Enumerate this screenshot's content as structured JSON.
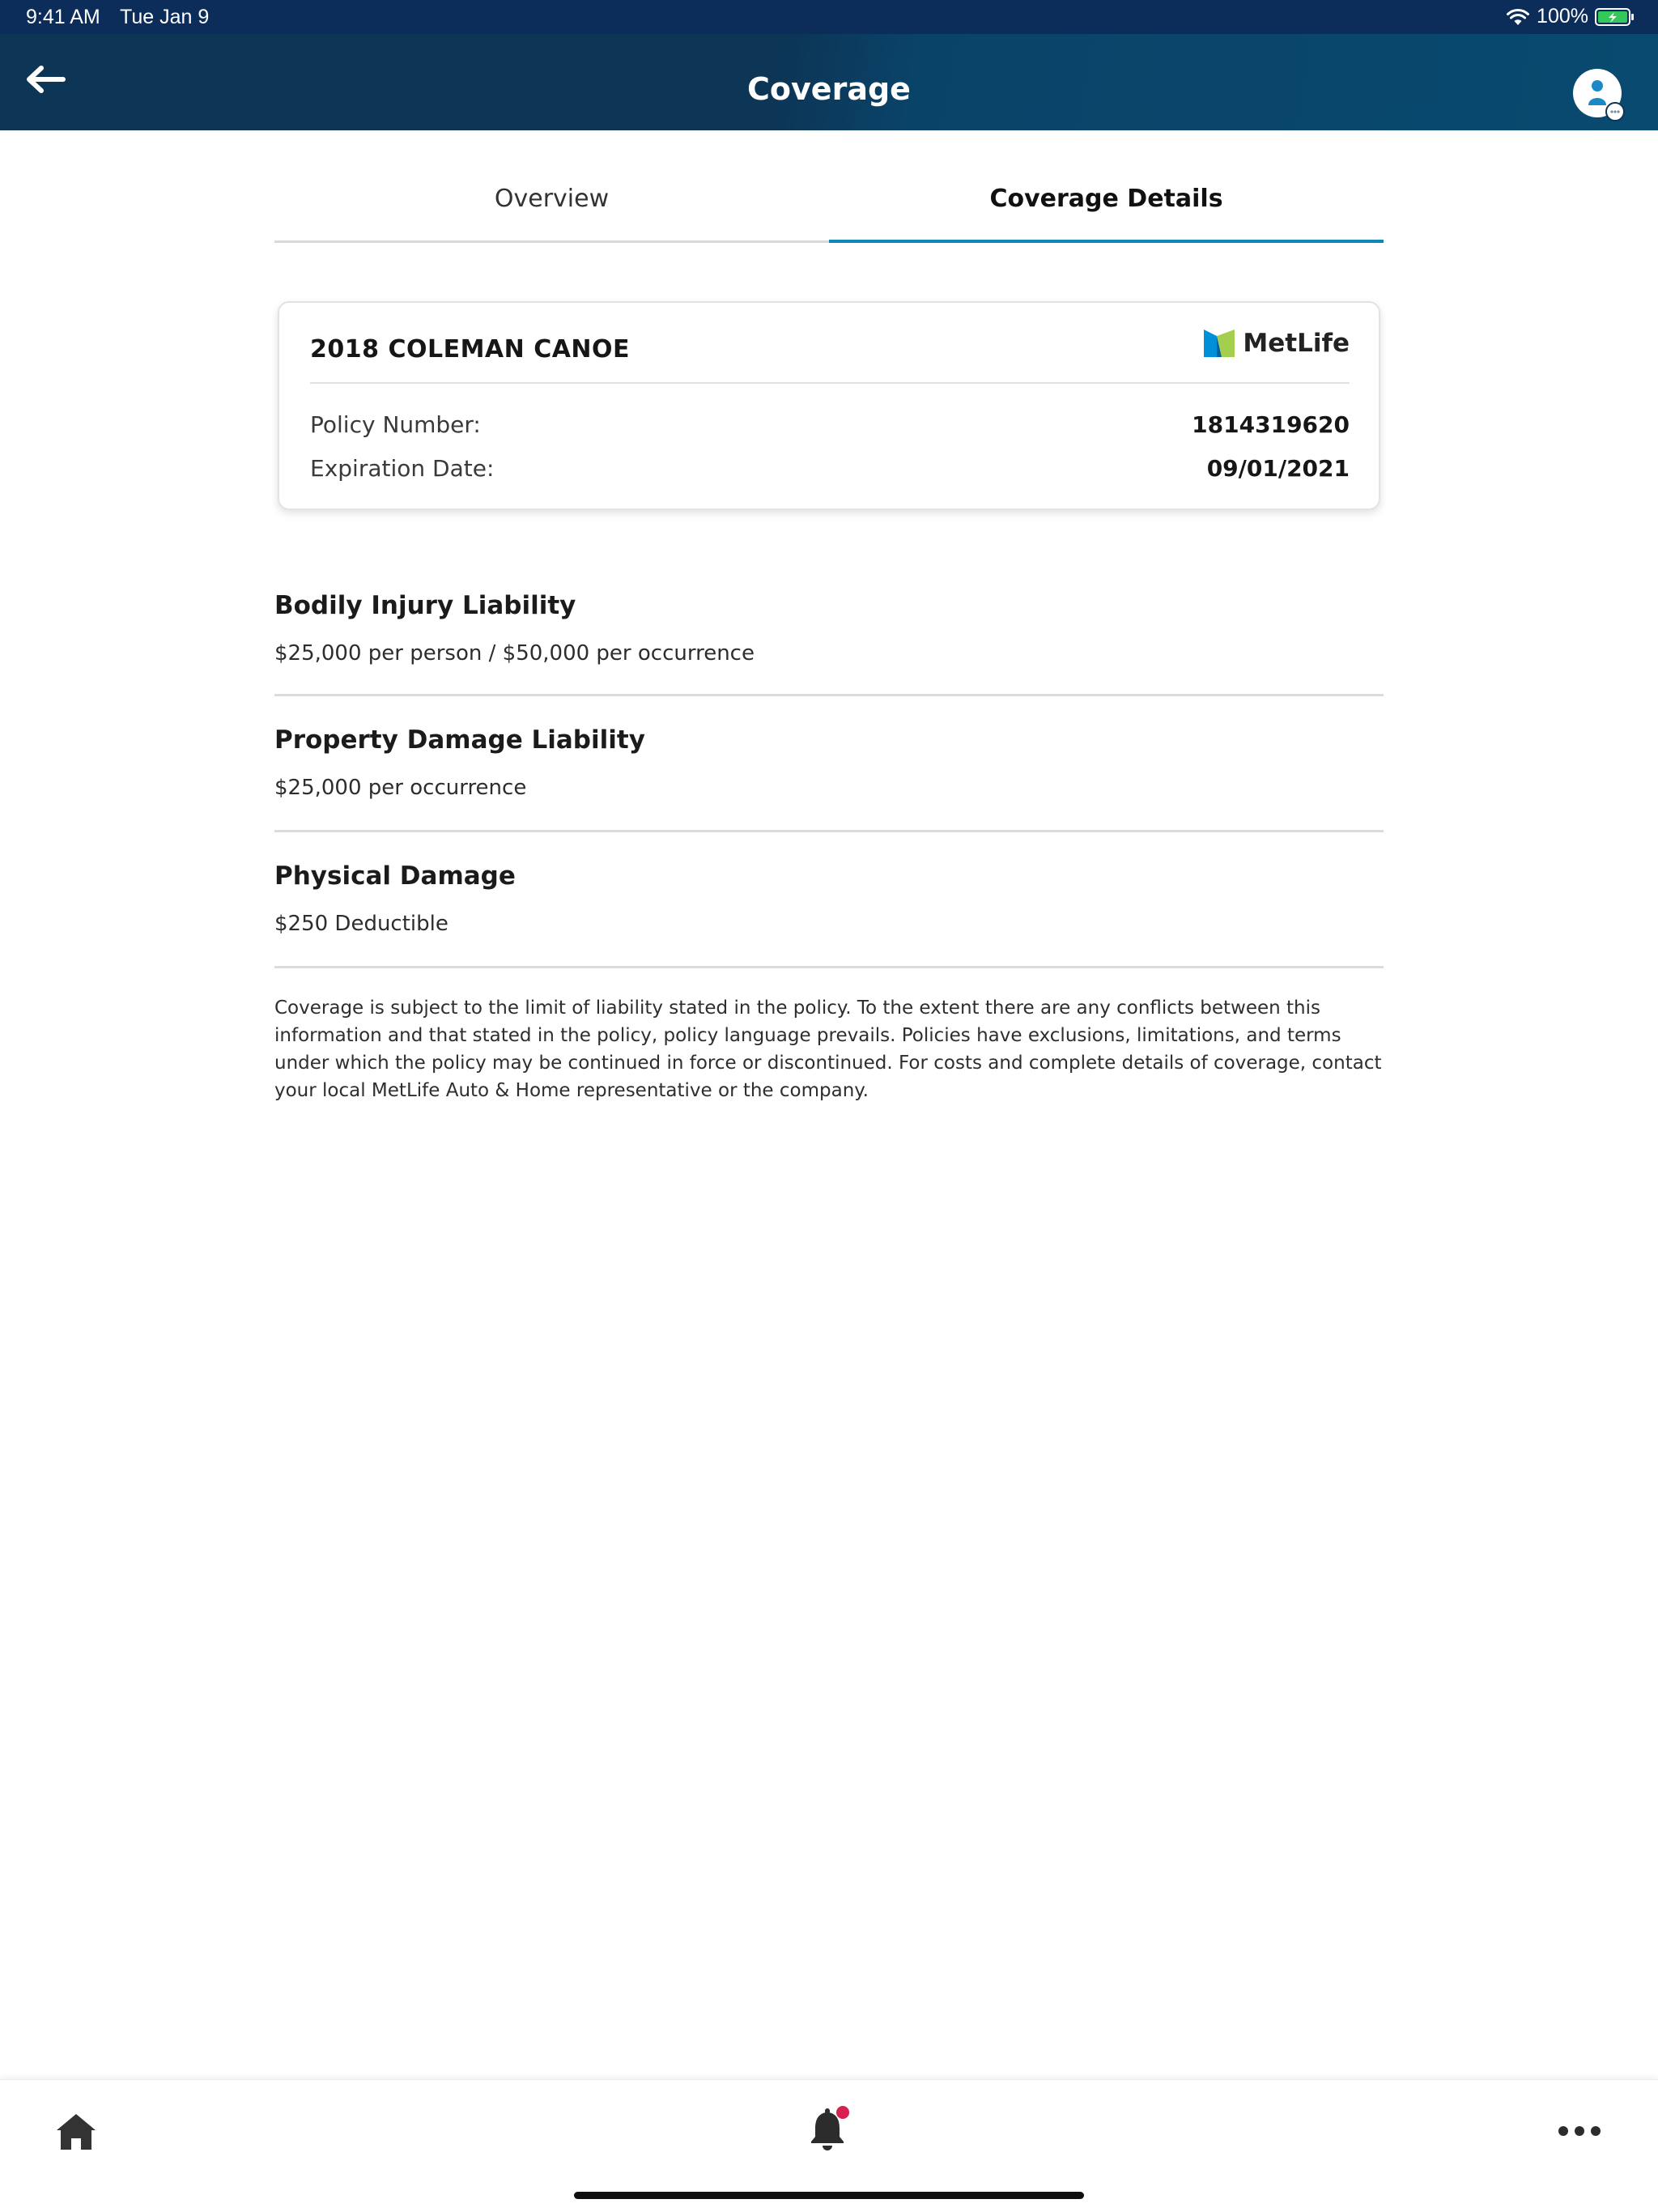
{
  "status_bar": {
    "time": "9:41 AM",
    "date": "Tue Jan 9",
    "battery": "100%",
    "icons": [
      "wifi-icon",
      "battery-charging-icon"
    ]
  },
  "nav": {
    "title": "Coverage",
    "back_icon": "arrow-left-icon",
    "profile_icon": "user-avatar-icon"
  },
  "tabs": [
    {
      "label": "Overview",
      "active": false
    },
    {
      "label": "Coverage Details",
      "active": true
    }
  ],
  "policy_card": {
    "vehicle": "2018 COLEMAN CANOE",
    "carrier": "MetLife",
    "rows": [
      {
        "label": "Policy Number:",
        "value": "1814319620"
      },
      {
        "label": "Expiration Date:",
        "value": "09/01/2021"
      }
    ]
  },
  "coverages": [
    {
      "name": "Bodily Injury Liability",
      "value": "$25,000 per person / $50,000 per occurrence"
    },
    {
      "name": "Property Damage Liability",
      "value": "$25,000 per occurrence"
    },
    {
      "name": "Physical Damage",
      "value": "$250 Deductible"
    }
  ],
  "disclaimer": "Coverage is subject to the limit of liability stated in the policy. To the extent there are any conflicts between this information and that stated in the policy, policy language prevails. Policies have exclusions, limitations, and terms under which the policy may be continued in force or discontinued. For costs and complete details of coverage, contact your local MetLife Auto & Home representative or the company.",
  "bottom_nav": {
    "items": [
      "home-icon",
      "bell-icon",
      "more-dots-icon"
    ],
    "has_notification": true
  },
  "colors": {
    "nav_background": "#0c3556",
    "status_background": "#0c2d5a",
    "tab_accent": "#0d88b4",
    "notification_dot": "#d6204f",
    "metlife_blue": "#0090da",
    "metlife_green": "#a4ce4e"
  }
}
